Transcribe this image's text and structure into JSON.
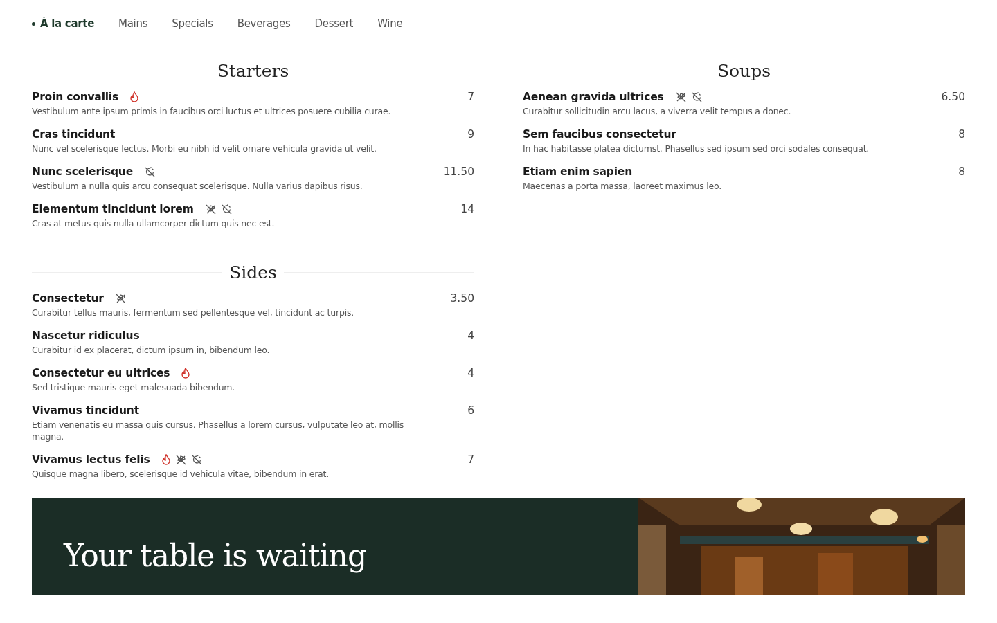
{
  "tabs": [
    {
      "label": "À la carte",
      "selected": true
    },
    {
      "label": "Mains",
      "selected": false
    },
    {
      "label": "Specials",
      "selected": false
    },
    {
      "label": "Beverages",
      "selected": false
    },
    {
      "label": "Dessert",
      "selected": false
    },
    {
      "label": "Wine",
      "selected": false
    }
  ],
  "columns": [
    {
      "sections": [
        {
          "title": "Starters",
          "items": [
            {
              "name": "Proin convallis",
              "tags": [
                {
                  "kind": "spicy"
                }
              ],
              "price": "7",
              "description": "Vestibulum ante ipsum primis in faucibus orci luctus et ultrices posuere cubilia curae."
            },
            {
              "name": "Cras tincidunt",
              "price": "9",
              "description": "Nunc vel scelerisque lectus. Morbi eu nibh id velit ornare vehicula gravida ut velit."
            },
            {
              "name": "Nunc scelerisque",
              "tags": [
                {
                  "kind": "allergen_free"
                }
              ],
              "price": "11.50",
              "description": "Vestibulum a nulla quis arcu consequat scelerisque. Nulla varius dapibus risus."
            },
            {
              "name": "Elementum tincidunt lorem",
              "tags": [
                {
                  "kind": "gluten_free"
                },
                {
                  "kind": "allergen_free"
                }
              ],
              "price": "14",
              "description": "Cras at metus quis nulla ullamcorper dictum quis nec est."
            }
          ]
        },
        {
          "title": "Sides",
          "items": [
            {
              "name": "Consectetur",
              "tags": [
                {
                  "kind": "gluten_free"
                }
              ],
              "price": "3.50",
              "description": "Curabitur tellus mauris, fermentum sed pellentesque vel, tincidunt ac turpis."
            },
            {
              "name": "Nascetur ridiculus",
              "price": "4",
              "description": "Curabitur id ex placerat, dictum ipsum in, bibendum leo."
            },
            {
              "name": "Consectetur eu ultrices",
              "tags": [
                {
                  "kind": "spicy"
                }
              ],
              "price": "4",
              "description": "Sed tristique mauris eget malesuada bibendum."
            },
            {
              "name": "Vivamus tincidunt",
              "price": "6",
              "description": "Etiam venenatis eu massa quis cursus. Phasellus a lorem cursus, vulputate leo at, mollis magna."
            },
            {
              "name": "Vivamus lectus felis",
              "tags": [
                {
                  "kind": "spicy"
                },
                {
                  "kind": "gluten_free"
                },
                {
                  "kind": "allergen_free"
                }
              ],
              "price": "7",
              "description": "Quisque magna libero, scelerisque id vehicula vitae, bibendum in erat."
            }
          ]
        }
      ]
    },
    {
      "sections": [
        {
          "title": "Soups",
          "items": [
            {
              "name": "Aenean gravida ultrices",
              "tags": [
                {
                  "kind": "gluten_free"
                },
                {
                  "kind": "allergen_free"
                }
              ],
              "price": "6.50",
              "description": "Curabitur sollicitudin arcu lacus, a viverra velit tempus a donec."
            },
            {
              "name": "Sem faucibus consectetur",
              "price": "8",
              "description": "In hac habitasse platea dictumst. Phasellus sed ipsum sed orci sodales consequat."
            },
            {
              "name": "Etiam enim sapien",
              "price": "8",
              "description": "Maecenas a porta massa, laoreet maximus leo."
            }
          ]
        }
      ]
    }
  ],
  "banner": {
    "heading": "Your table is waiting"
  }
}
